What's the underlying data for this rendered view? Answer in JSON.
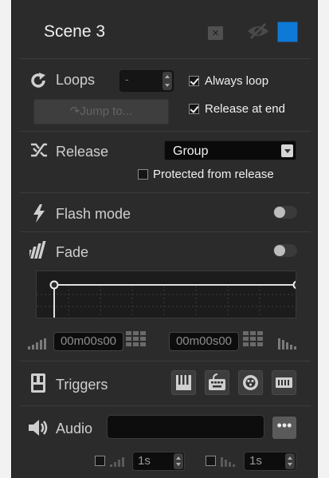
{
  "scene": {
    "title": "Scene 3"
  },
  "header": {
    "close_glyph": "×",
    "color": "#0e79d6"
  },
  "loops": {
    "label": "Loops",
    "value": "-",
    "jump_label": "Jump to...",
    "always_loop_label": "Always loop",
    "always_loop_checked": true,
    "release_at_end_label": "Release at end",
    "release_at_end_checked": true
  },
  "release": {
    "label": "Release",
    "selected": "Group",
    "protected_label": "Protected from release",
    "protected_checked": false
  },
  "flash": {
    "label": "Flash mode",
    "enabled": false
  },
  "fade": {
    "label": "Fade",
    "enabled": false,
    "fade_in_time": "00m00s00",
    "fade_out_time": "00m00s00"
  },
  "triggers": {
    "label": "Triggers"
  },
  "audio": {
    "label": "Audio",
    "file": "",
    "more_glyph": "•••",
    "fade_in": "1s",
    "fade_out": "1s"
  }
}
